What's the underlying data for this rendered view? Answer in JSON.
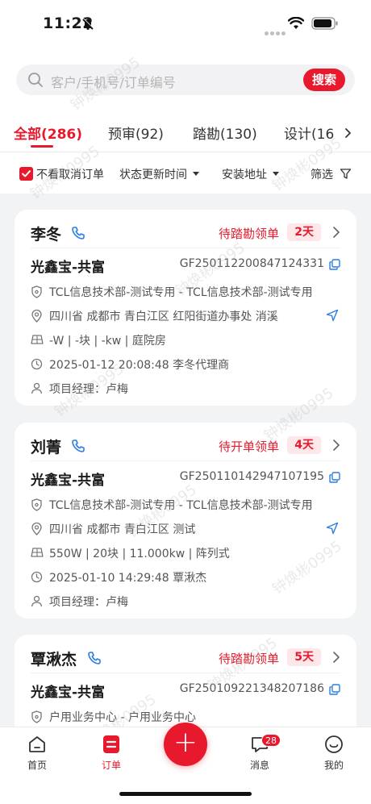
{
  "status_bar": {
    "time": "11:22"
  },
  "search": {
    "placeholder": "客户/手机号/订单编号",
    "button": "搜索"
  },
  "tabs": [
    {
      "label": "全部(286)",
      "active": true
    },
    {
      "label": "预审(92)",
      "active": false
    },
    {
      "label": "踏勘(130)",
      "active": false
    },
    {
      "label": "设计(16",
      "active": false
    }
  ],
  "filters": {
    "hide_cancelled": "不看取消订单",
    "sort": "状态更新时间",
    "address": "安装地址",
    "filter": "筛选"
  },
  "orders": [
    {
      "customer": "李冬",
      "status": "待踏勘领单",
      "days": "2天",
      "company": "光鑫宝-共富",
      "code": "GF250112200847124331",
      "org": "TCL信息技术部-测试专用 - TCL信息技术部-测试专用",
      "address": "四川省 成都市 青白江区 红阳街道办事处 消溪",
      "specs": "-W | -块 | -kw | 庭院房",
      "datetime": "2025-01-12 20:08:48  李冬代理商",
      "manager": "项目经理：卢梅"
    },
    {
      "customer": "刘菁",
      "status": "待开单领单",
      "days": "4天",
      "company": "光鑫宝-共富",
      "code": "GF250110142947107195",
      "org": "TCL信息技术部-测试专用 - TCL信息技术部-测试专用",
      "address": "四川省 成都市 青白江区  测试",
      "specs": "550W | 20块 | 11.000kw | 阵列式",
      "datetime": "2025-01-10 14:29:48  覃湫杰",
      "manager": "项目经理：卢梅"
    },
    {
      "customer": "覃湫杰",
      "status": "待踏勘领单",
      "days": "5天",
      "company": "光鑫宝-共富",
      "code": "GF250109221348207186",
      "org": "户用业务中心 - 户用业务中心"
    }
  ],
  "tabbar": {
    "home": "首页",
    "orders": "订单",
    "messages": "消息",
    "messages_badge": "28",
    "mine": "我的"
  },
  "watermark": "钟焕彬0995",
  "colors": {
    "accent": "#e8192c",
    "badge_bg": "#fde7e9",
    "page_bg": "#f2f3f5"
  }
}
